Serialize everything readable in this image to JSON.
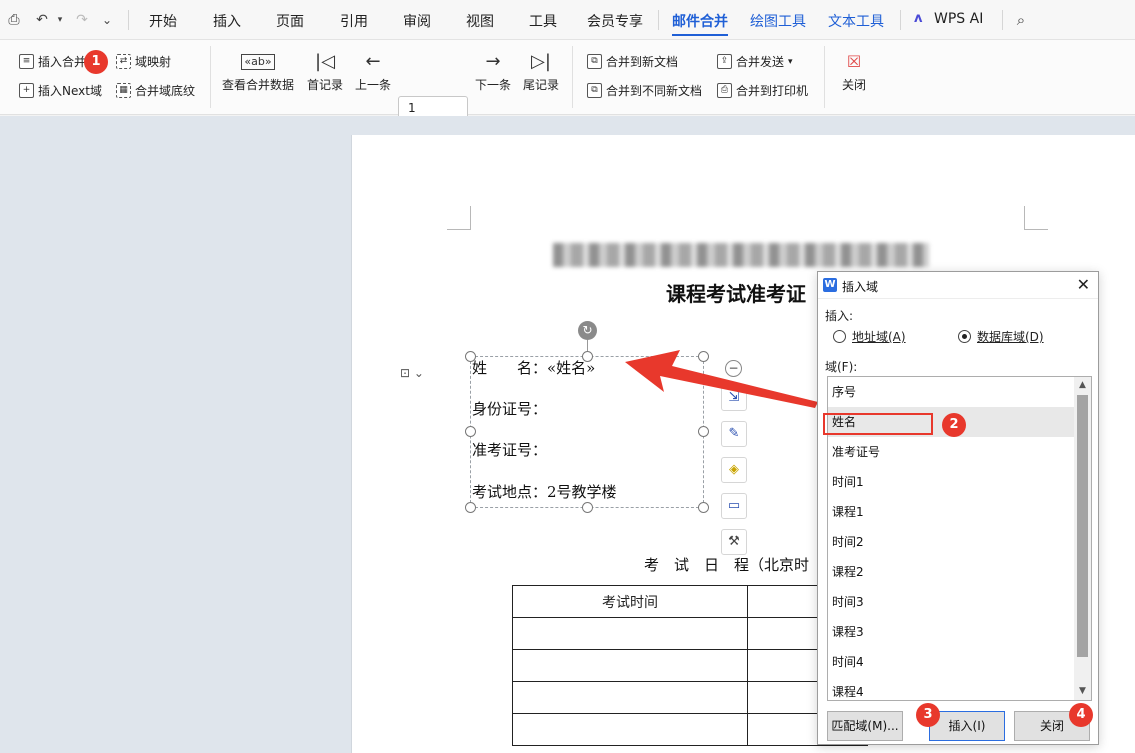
{
  "menubar": {
    "tabs": [
      "开始",
      "插入",
      "页面",
      "引用",
      "审阅",
      "视图",
      "工具",
      "会员专享",
      "邮件合并",
      "绘图工具",
      "文本工具",
      "WPS AI"
    ],
    "active_tab": "邮件合并"
  },
  "ribbon": {
    "insert_merge_field": "插入合并域",
    "insert_next": "插入Next域",
    "field_mapping": "域映射",
    "merge_field_shading": "合并域底纹",
    "view_merge_data": "查看合并数据",
    "first_record": "首记录",
    "prev_record": "上一条",
    "record_number": "1",
    "next_record": "下一条",
    "last_record": "尾记录",
    "merge_to_new_doc": "合并到新文档",
    "merge_to_separate_docs": "合并到不同新文档",
    "merge_send": "合并发送",
    "merge_to_printer": "合并到打印机",
    "close": "关闭"
  },
  "document": {
    "title": "课程考试准考证",
    "textbox_lines": [
      "姓　　名：«姓名»",
      "身份证号：",
      "准考证号：",
      "考试地点：2号教学楼"
    ],
    "schedule_label": "考　试　日　程（北京时",
    "table_header": "考试时间"
  },
  "dialog": {
    "title": "插入域",
    "insert_label": "插入:",
    "radio_address": "地址域(A)",
    "radio_database": "数据库域(D)",
    "selected_radio": "数据库域(D)",
    "field_label": "域(F):",
    "fields": [
      "序号",
      "姓名",
      "准考证号",
      "时间1",
      "课程1",
      "时间2",
      "课程2",
      "时间3",
      "课程3",
      "时间4",
      "课程4"
    ],
    "selected_field": "姓名",
    "btn_match": "匹配域(M)...",
    "btn_insert": "插入(I)",
    "btn_close": "关闭"
  },
  "callouts": [
    "1",
    "2",
    "3",
    "4"
  ],
  "colors": {
    "accent": "#1f5fd6",
    "callout_red": "#e8382c"
  }
}
